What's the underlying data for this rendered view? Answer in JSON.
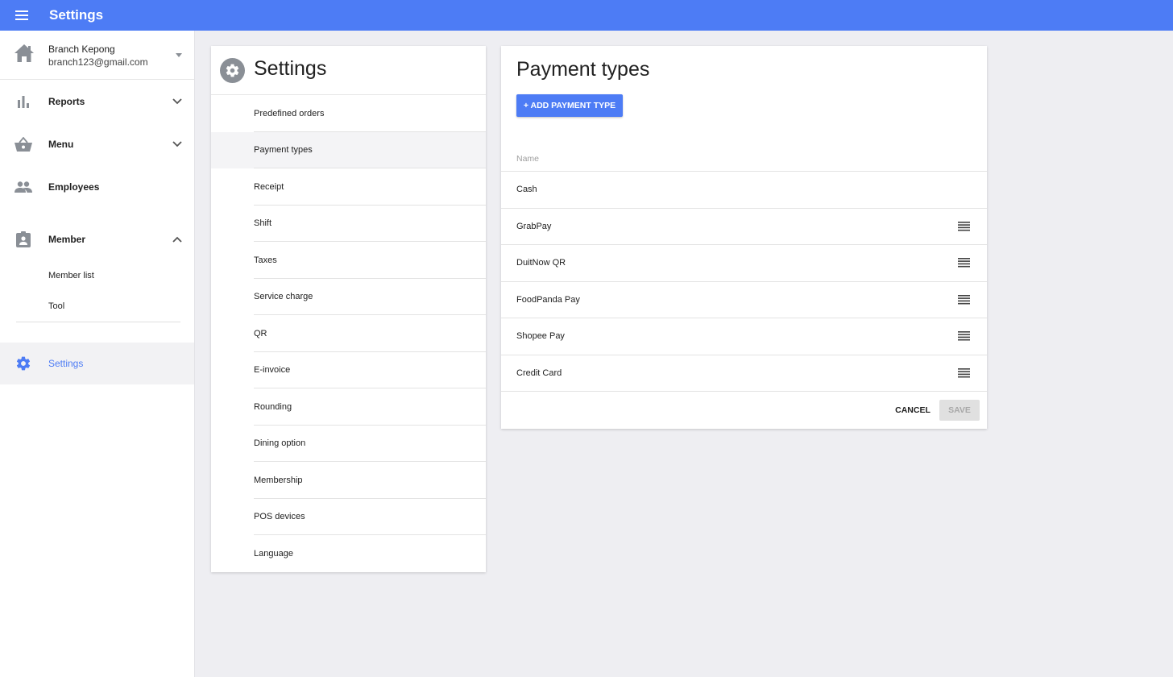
{
  "topbar": {
    "title": "Settings"
  },
  "account": {
    "name": "Branch Kepong",
    "email": "branch123@gmail.com"
  },
  "sidebar": {
    "items": [
      {
        "label": "Reports"
      },
      {
        "label": "Menu"
      },
      {
        "label": "Employees"
      },
      {
        "label": "Member"
      },
      {
        "label": "Settings"
      }
    ],
    "member_sub": [
      {
        "label": "Member list"
      },
      {
        "label": "Tool"
      }
    ]
  },
  "settings_list": {
    "title": "Settings",
    "items": [
      {
        "label": "Predefined orders"
      },
      {
        "label": "Payment types"
      },
      {
        "label": "Receipt"
      },
      {
        "label": "Shift"
      },
      {
        "label": "Taxes"
      },
      {
        "label": "Service charge"
      },
      {
        "label": "QR"
      },
      {
        "label": "E-invoice"
      },
      {
        "label": "Rounding"
      },
      {
        "label": "Dining option"
      },
      {
        "label": "Membership"
      },
      {
        "label": "POS devices"
      },
      {
        "label": "Language"
      }
    ],
    "selected": "Payment types"
  },
  "payment": {
    "title": "Payment types",
    "add_label": "+ ADD PAYMENT TYPE",
    "column_name": "Name",
    "rows": [
      {
        "name": "Cash"
      },
      {
        "name": "GrabPay"
      },
      {
        "name": "DuitNow QR"
      },
      {
        "name": "FoodPanda Pay"
      },
      {
        "name": "Shopee Pay"
      },
      {
        "name": "Credit Card"
      }
    ],
    "cancel_label": "CANCEL",
    "save_label": "SAVE"
  },
  "colors": {
    "accent": "#4d7cf5",
    "icon_gray": "#8a8f96",
    "background": "#eeeef2"
  }
}
